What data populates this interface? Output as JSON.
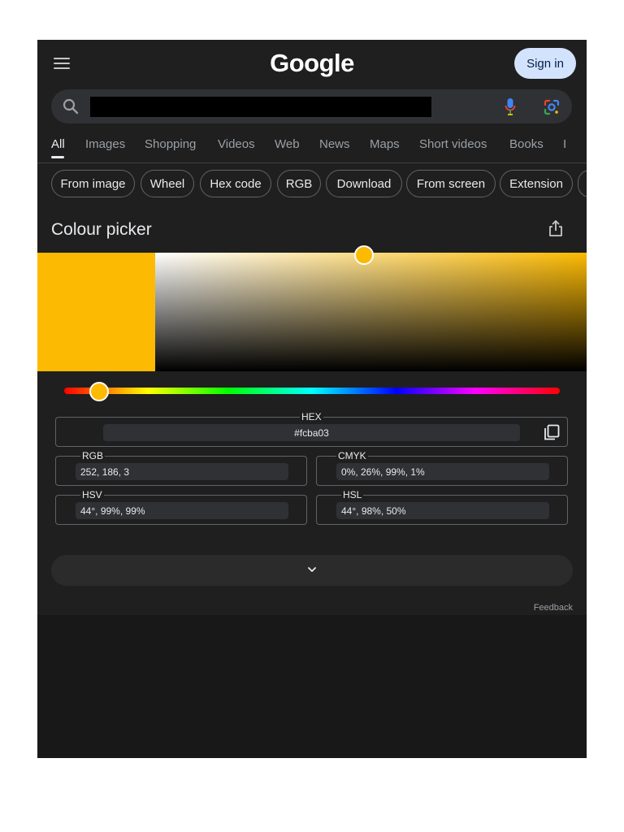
{
  "header": {
    "logo": "Google",
    "sign_in": "Sign in"
  },
  "search": {
    "value": ""
  },
  "tabs": [
    {
      "label": "All"
    },
    {
      "label": "Images"
    },
    {
      "label": "Shopping"
    },
    {
      "label": "Videos"
    },
    {
      "label": "Web"
    },
    {
      "label": "News"
    },
    {
      "label": "Maps"
    },
    {
      "label": "Short videos"
    },
    {
      "label": "Books"
    },
    {
      "label": "I"
    }
  ],
  "chips": [
    {
      "label": "From image"
    },
    {
      "label": "Wheel"
    },
    {
      "label": "Hex code"
    },
    {
      "label": "RGB"
    },
    {
      "label": "Download"
    },
    {
      "label": "From screen"
    },
    {
      "label": "Extension"
    }
  ],
  "picker": {
    "title": "Colour picker",
    "selected_color": "#fcba03",
    "hue_fraction": 0.12,
    "hex": {
      "label": "HEX",
      "value": "#fcba03"
    },
    "rgb": {
      "label": "RGB",
      "value": "252, 186, 3"
    },
    "cmyk": {
      "label": "CMYK",
      "value": "0%, 26%, 99%, 1%"
    },
    "hsv": {
      "label": "HSV",
      "value": "44°, 99%, 99%"
    },
    "hsl": {
      "label": "HSL",
      "value": "44°, 98%, 50%"
    }
  },
  "footer": {
    "feedback": "Feedback"
  },
  "colors": {
    "background": "#1f1f1f",
    "sign_in_bg": "#d3e3fd",
    "accent": "#fcba03"
  }
}
